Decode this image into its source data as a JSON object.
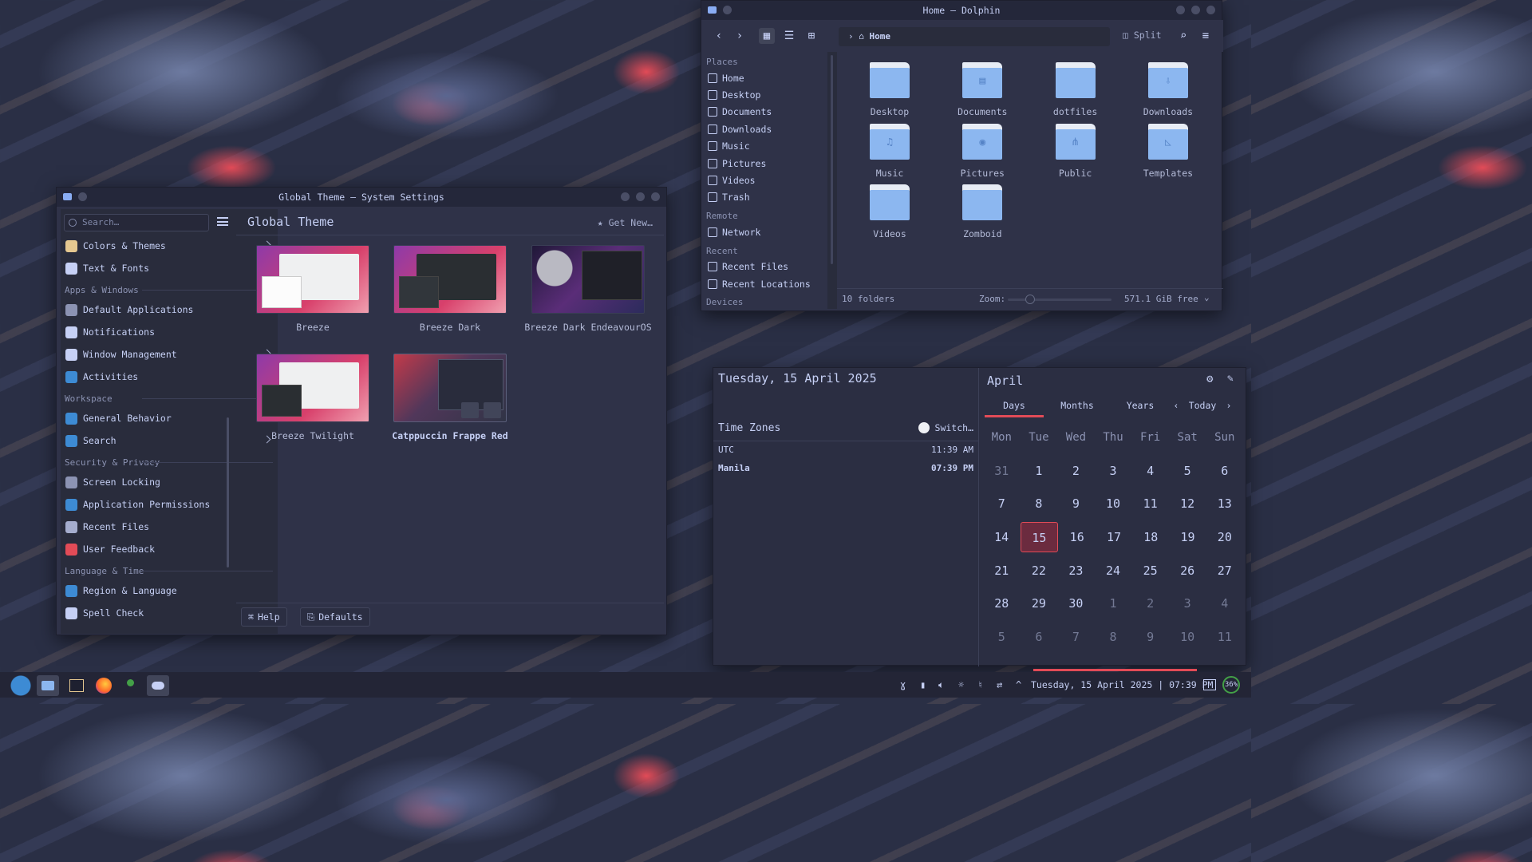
{
  "settings": {
    "title": "Global Theme — System Settings",
    "search_placeholder": "Search…",
    "page_title": "Global Theme",
    "get_new": "Get New…",
    "nav": [
      {
        "label": "Colors & Themes",
        "type": "item",
        "chev": true,
        "color": "#e5c890"
      },
      {
        "label": "Text & Fonts",
        "type": "item",
        "chev": true,
        "color": "#c6d0f5"
      },
      {
        "label": "Apps & Windows",
        "type": "section"
      },
      {
        "label": "Default Applications",
        "type": "item",
        "chev": true,
        "color": "#8c93b3"
      },
      {
        "label": "Notifications",
        "type": "item",
        "chev": false,
        "color": "#c6d0f5"
      },
      {
        "label": "Window Management",
        "type": "item",
        "chev": true,
        "color": "#c6d0f5"
      },
      {
        "label": "Activities",
        "type": "item",
        "chev": false,
        "color": "#3d8bd4"
      },
      {
        "label": "Workspace",
        "type": "section"
      },
      {
        "label": "General Behavior",
        "type": "item",
        "chev": false,
        "color": "#3d8bd4"
      },
      {
        "label": "Search",
        "type": "item",
        "chev": true,
        "color": "#3d8bd4"
      },
      {
        "label": "Security & Privacy",
        "type": "section"
      },
      {
        "label": "Screen Locking",
        "type": "item",
        "chev": false,
        "color": "#8c93b3"
      },
      {
        "label": "Application Permissions",
        "type": "item",
        "chev": false,
        "color": "#3d8bd4"
      },
      {
        "label": "Recent Files",
        "type": "item",
        "chev": false,
        "color": "#a5adce"
      },
      {
        "label": "User Feedback",
        "type": "item",
        "chev": false,
        "color": "#e24b57"
      },
      {
        "label": "Language & Time",
        "type": "section"
      },
      {
        "label": "Region & Language",
        "type": "item",
        "chev": false,
        "color": "#3d8bd4"
      },
      {
        "label": "Spell Check",
        "type": "item",
        "chev": false,
        "color": "#c6d0f5"
      }
    ],
    "themes": [
      "Breeze",
      "Breeze Dark",
      "Breeze Dark EndeavourOS",
      "Breeze Twilight",
      "Catppuccin Frappe Red"
    ],
    "help": "Help",
    "defaults": "Defaults"
  },
  "dolphin": {
    "title": "Home — Dolphin",
    "split": "Split",
    "breadcrumb": "Home",
    "places_sections": {
      "places": "Places",
      "remote": "Remote",
      "recent": "Recent",
      "devices": "Devices"
    },
    "places": [
      "Home",
      "Desktop",
      "Documents",
      "Downloads",
      "Music",
      "Pictures",
      "Videos",
      "Trash"
    ],
    "remote": [
      "Network"
    ],
    "recent": [
      "Recent Files",
      "Recent Locations"
    ],
    "files": [
      "Desktop",
      "Documents",
      "dotfiles",
      "Downloads",
      "Music",
      "Pictures",
      "Public",
      "Templates",
      "Videos",
      "Zomboid"
    ],
    "status": {
      "count": "10 folders",
      "zoom": "Zoom:",
      "free": "571.1 GiB free"
    }
  },
  "calendar": {
    "date_long": "Tuesday, 15 April 2025",
    "timezones_title": "Time Zones",
    "switch": "Switch…",
    "zones": [
      {
        "name": "UTC",
        "time": "11:39 AM"
      },
      {
        "name": "Manila",
        "time": "07:39 PM"
      }
    ],
    "month": "April",
    "tabs": [
      "Days",
      "Months",
      "Years"
    ],
    "today": "Today",
    "weekdays": [
      "Mon",
      "Tue",
      "Wed",
      "Thu",
      "Fri",
      "Sat",
      "Sun"
    ],
    "weeks": [
      [
        "31",
        "1",
        "2",
        "3",
        "4",
        "5",
        "6"
      ],
      [
        "7",
        "8",
        "9",
        "10",
        "11",
        "12",
        "13"
      ],
      [
        "14",
        "15",
        "16",
        "17",
        "18",
        "19",
        "20"
      ],
      [
        "21",
        "22",
        "23",
        "24",
        "25",
        "26",
        "27"
      ],
      [
        "28",
        "29",
        "30",
        "1",
        "2",
        "3",
        "4"
      ],
      [
        "5",
        "6",
        "7",
        "8",
        "9",
        "10",
        "11"
      ]
    ],
    "today_date": "15"
  },
  "taskbar": {
    "clock": "Tuesday, 15 April 2025 | 07:39 PM",
    "battery": "36%",
    "apps": [
      "kde-launcher-icon",
      "dolphin-icon",
      "terminal-icon",
      "firefox-icon",
      "joystick-icon",
      "settings-icon"
    ]
  },
  "colors": {
    "accent": "#e24b57",
    "folder": "#8cb7f0",
    "bg": "#2f3248"
  }
}
